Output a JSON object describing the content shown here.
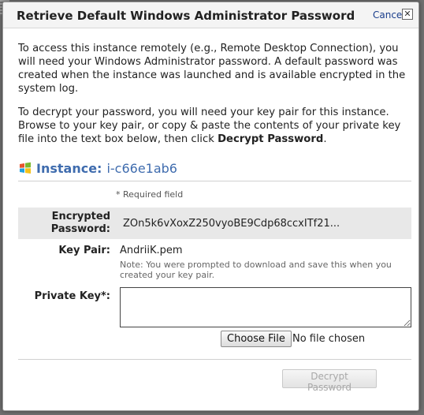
{
  "dialog": {
    "title": "Retrieve Default Windows Administrator Password",
    "cancel_label": "Cancel",
    "close_glyph": "✕"
  },
  "body": {
    "paragraph1": "To access this instance remotely (e.g., Remote Desktop Connection), you will need your Windows Administrator password. A default password was created when the instance was launched and is available encrypted in the system log.",
    "paragraph2_prefix": "To decrypt your password, you will need your key pair for this instance. Browse to your key pair, or copy & paste the contents of your private key file into the text box below, then click ",
    "paragraph2_bold": "Decrypt Password",
    "paragraph2_suffix": "."
  },
  "instance": {
    "label": "Instance:",
    "id": "i-c66e1ab6",
    "icon": "windows-logo-icon"
  },
  "form": {
    "required_note": "* Required field",
    "encrypted_password_label_line1": "Encrypted",
    "encrypted_password_label_line2": "Password:",
    "encrypted_password_value": "ZOn5k6vXoxZ250vyoBE9Cdp68ccxITf21...",
    "key_pair_label": "Key Pair:",
    "key_pair_value": "AndriiK.pem",
    "key_pair_note": "Note: You were prompted to download and save this when you created your key pair.",
    "private_key_label": "Private Key*:",
    "private_key_value": "",
    "choose_file_label": "Choose File",
    "file_status": "No file chosen"
  },
  "footer": {
    "decrypt_button_label": "Decrypt Password",
    "decrypt_button_enabled": false
  },
  "colors": {
    "instance_text": "#3f6cae",
    "link": "#1a3e8c",
    "row_highlight": "#e8e8e8"
  }
}
